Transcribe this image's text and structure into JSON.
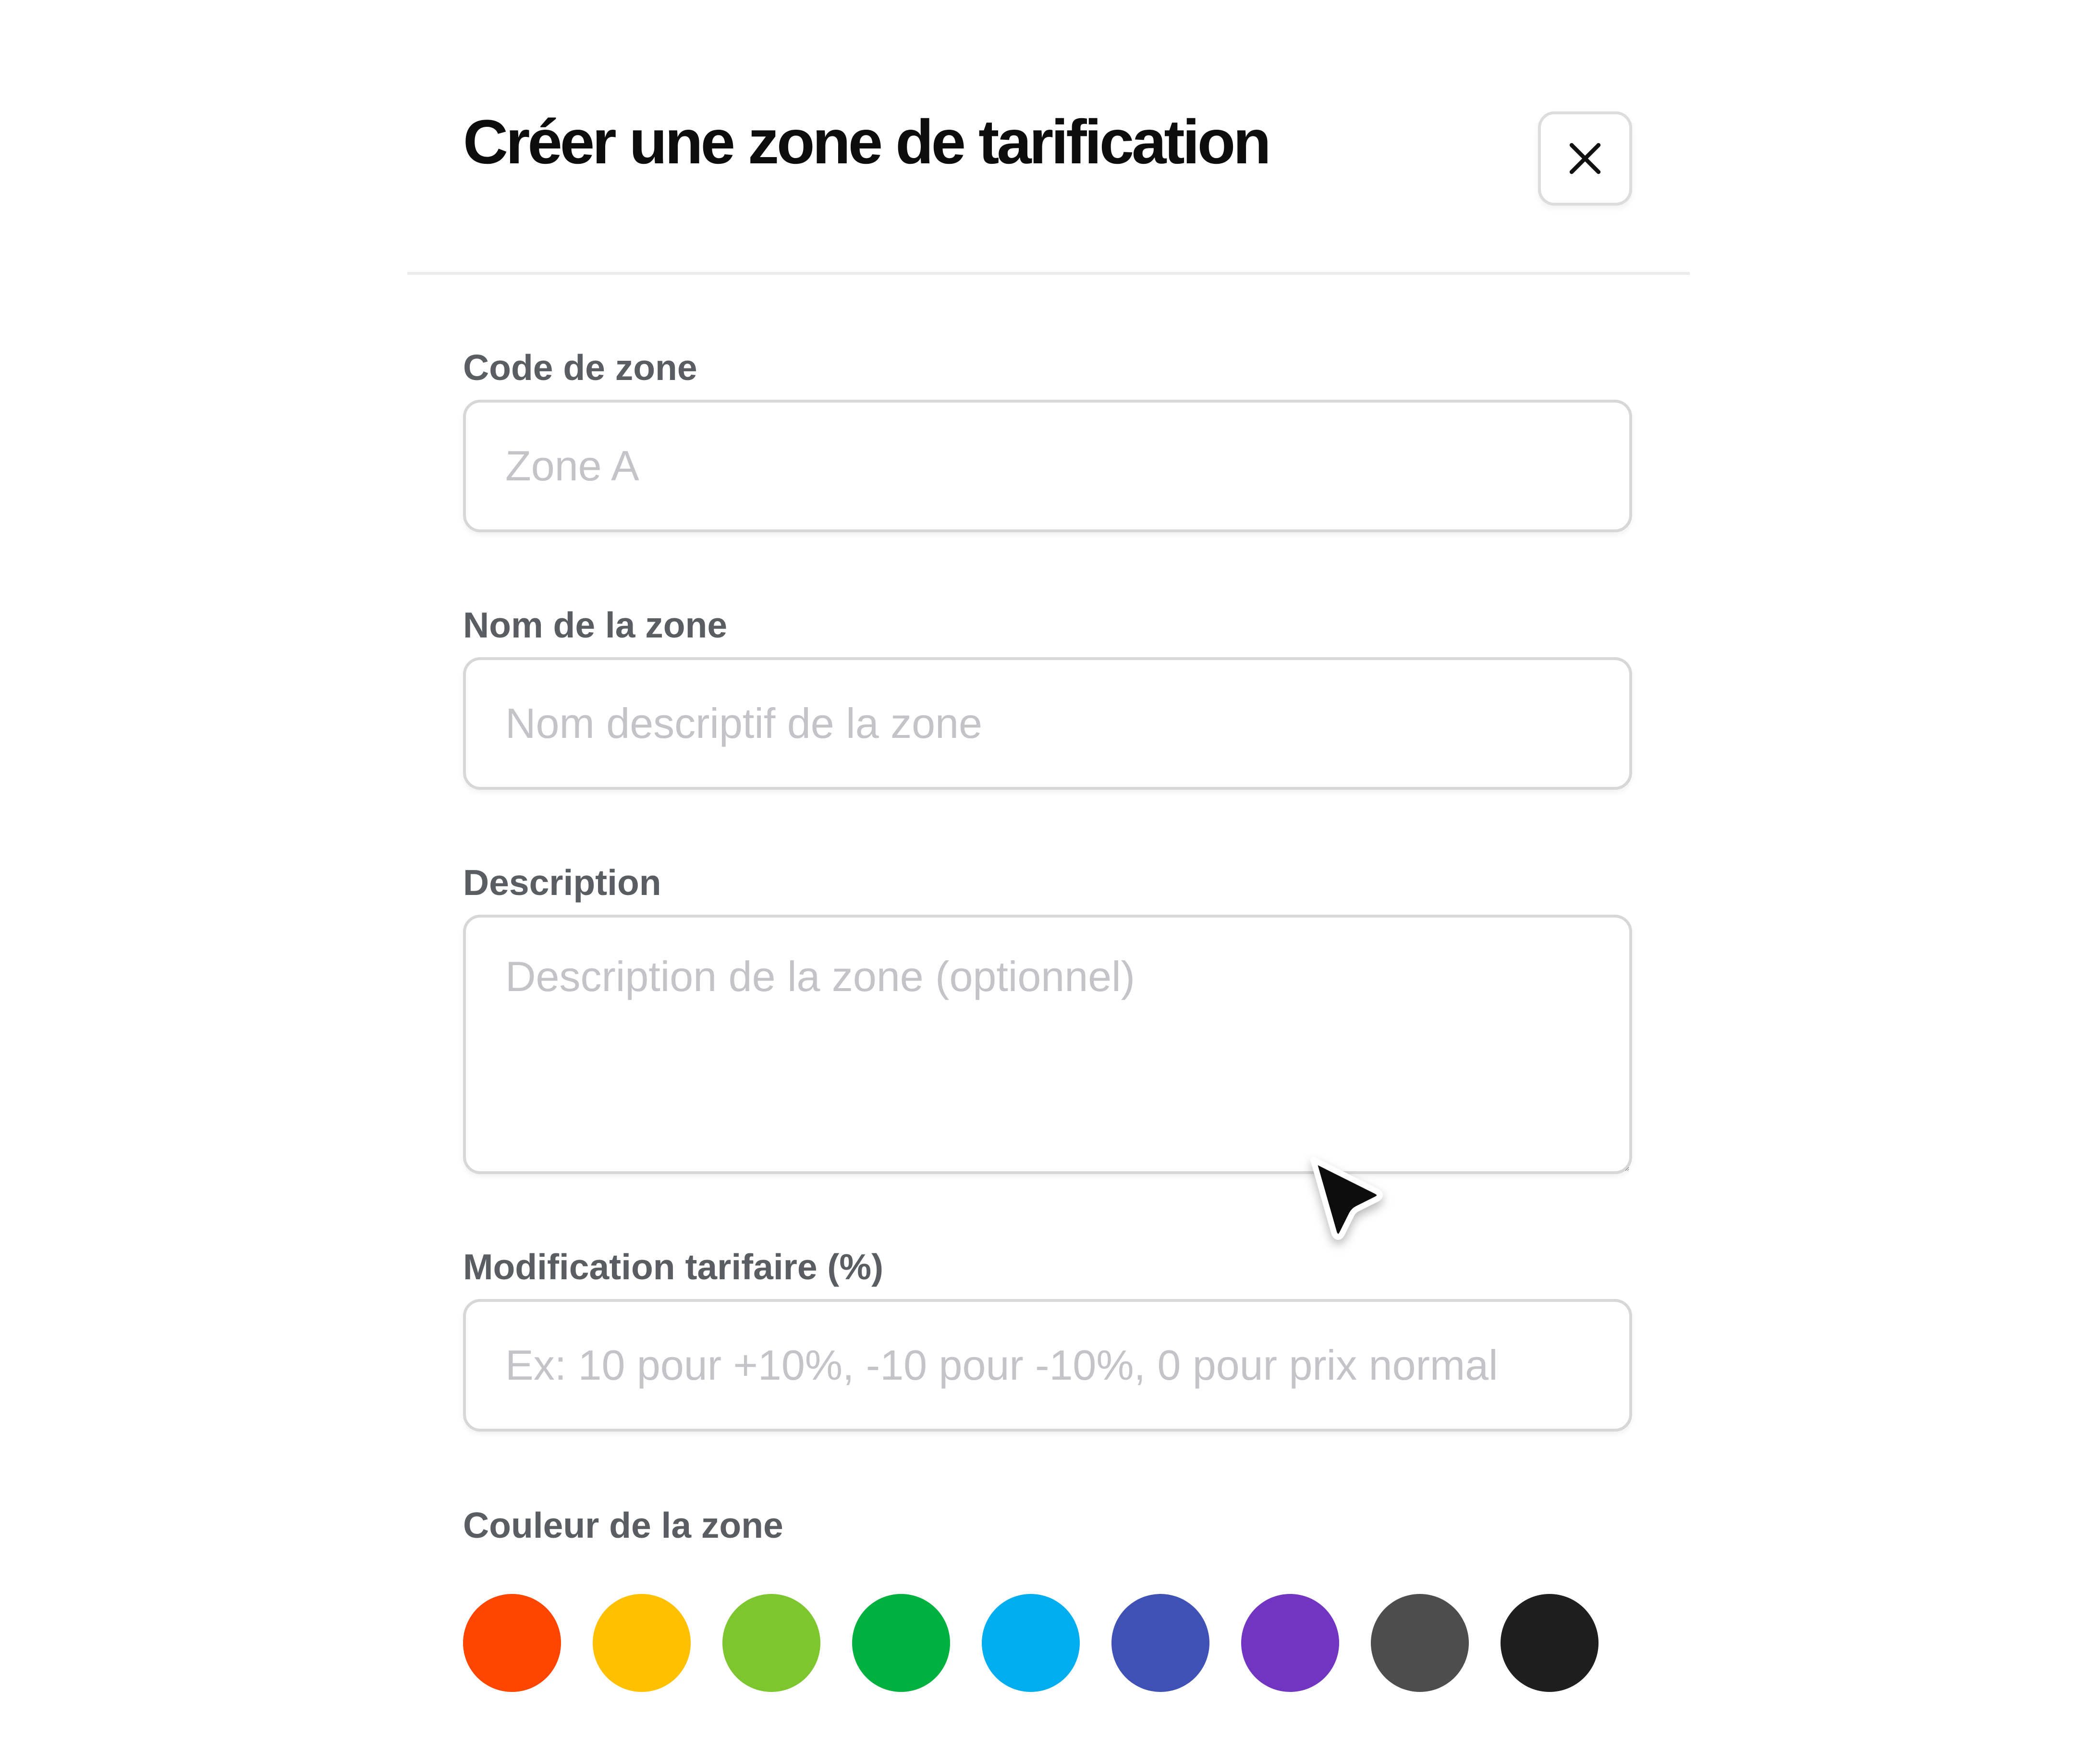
{
  "modal": {
    "title": "Créer une zone de tarification",
    "close_icon": "close-icon"
  },
  "form": {
    "zone_code": {
      "label": "Code de zone",
      "placeholder": "Zone A",
      "value": ""
    },
    "zone_name": {
      "label": "Nom de la zone",
      "placeholder": "Nom descriptif de la zone",
      "value": ""
    },
    "description": {
      "label": "Description",
      "placeholder": "Description de la zone (optionnel)",
      "value": ""
    },
    "price_modification": {
      "label": "Modification tarifaire (%)",
      "placeholder": "Ex: 10 pour +10%, -10 pour -10%, 0 pour prix normal",
      "value": ""
    },
    "zone_color": {
      "label": "Couleur de la zone",
      "swatches": [
        "#FF4500",
        "#FFC000",
        "#7DC62F",
        "#00B140",
        "#00AEEF",
        "#3F51B5",
        "#7135C2",
        "#4D4D4D",
        "#1F1F1F"
      ]
    }
  },
  "cursor_icon": "pointer-arrow-icon"
}
